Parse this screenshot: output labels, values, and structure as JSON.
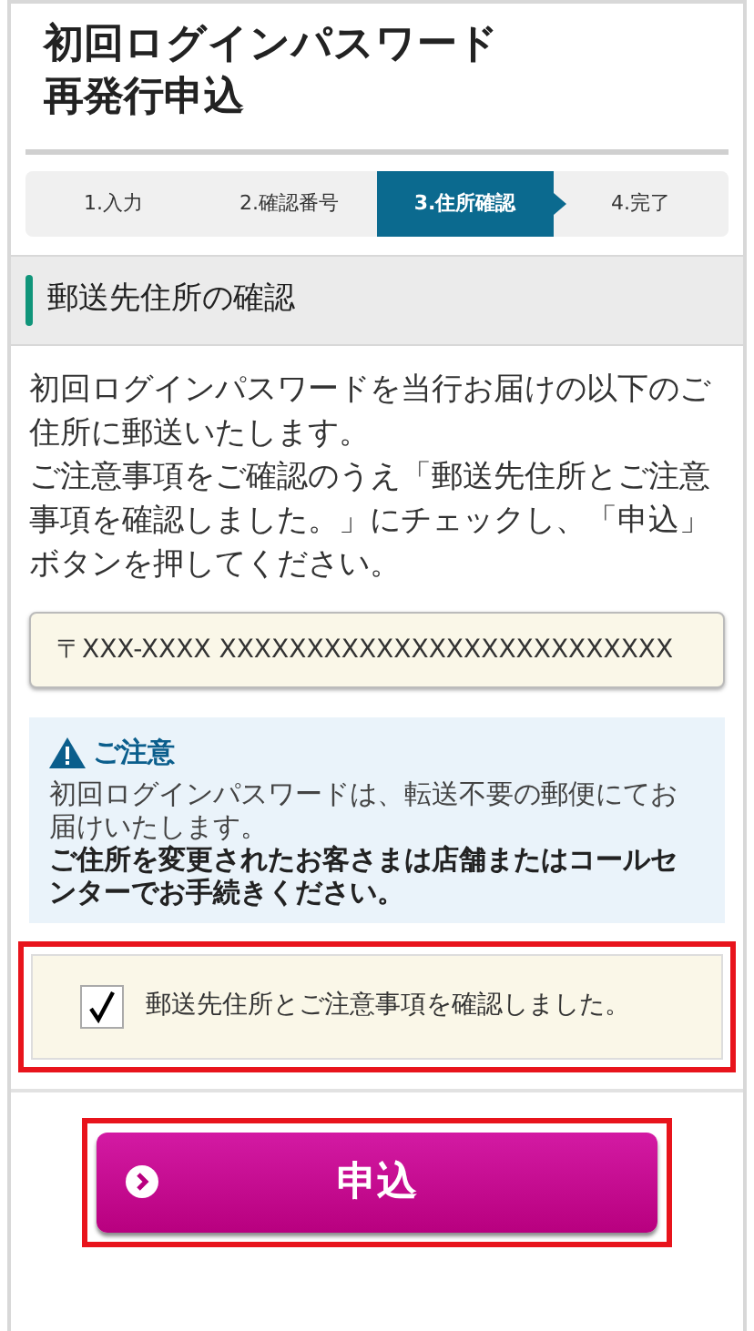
{
  "title": [
    "初回ログインパスワード",
    "再発行申込"
  ],
  "steps": [
    {
      "label": "1.入力",
      "selected": false
    },
    {
      "label": "2.確認番号",
      "selected": false
    },
    {
      "label": "3.住所確認",
      "selected": true
    },
    {
      "label": "4.完了",
      "selected": false
    }
  ],
  "section_heading": "郵送先住所の確認",
  "intro": [
    "初回ログインパスワードを当行お届けの以下のご住所に郵送いたします。",
    "ご注意事項をご確認のうえ「郵送先住所とご注意事項を確認しました。」にチェックし、「申込」ボタンを押してください。"
  ],
  "address": "〒XXX-XXXX XXXXXXXXXXXXXXXXXXXXXXXXXX",
  "notice": {
    "heading": "ご注意",
    "text": "初回ログインパスワードは、転送不要の郵便にてお届けいたします。",
    "emphasis": "ご住所を変更されたお客さまは店舗またはコールセンターでお手続きください。"
  },
  "confirm": {
    "label": "郵送先住所とご注意事項を確認しました。",
    "checked": true,
    "highlighted": true
  },
  "submit": {
    "label": "申込",
    "highlighted": true
  }
}
